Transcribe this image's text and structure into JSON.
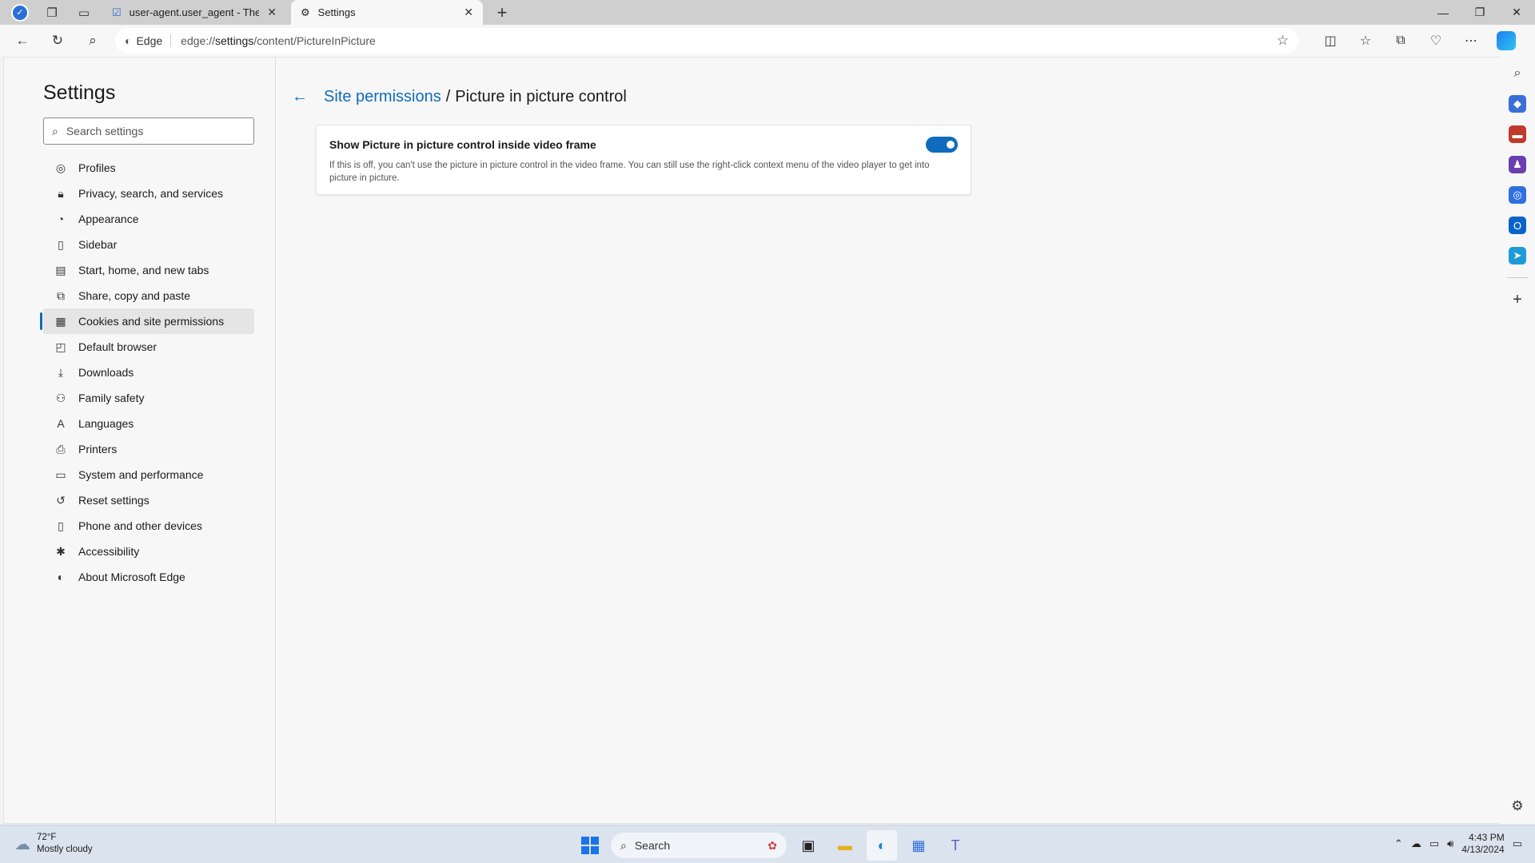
{
  "browser": {
    "tabs": [
      {
        "title": "user-agent.user_agent - The Coll",
        "active": false
      },
      {
        "title": "Settings",
        "active": true
      }
    ],
    "omnibox": {
      "brand": "Edge",
      "url_prefix": "edge://",
      "url_host": "settings",
      "url_path": "/content/PictureInPicture"
    }
  },
  "settings": {
    "title": "Settings",
    "search_placeholder": "Search settings",
    "nav_items": [
      {
        "label": "Profiles",
        "icon": "profile-icon"
      },
      {
        "label": "Privacy, search, and services",
        "icon": "lock-icon"
      },
      {
        "label": "Appearance",
        "icon": "appearance-icon"
      },
      {
        "label": "Sidebar",
        "icon": "sidebar-icon"
      },
      {
        "label": "Start, home, and new tabs",
        "icon": "home-icon"
      },
      {
        "label": "Share, copy and paste",
        "icon": "share-icon"
      },
      {
        "label": "Cookies and site permissions",
        "icon": "cookie-icon",
        "selected": true
      },
      {
        "label": "Default browser",
        "icon": "browser-icon"
      },
      {
        "label": "Downloads",
        "icon": "download-icon"
      },
      {
        "label": "Family safety",
        "icon": "family-icon"
      },
      {
        "label": "Languages",
        "icon": "language-icon"
      },
      {
        "label": "Printers",
        "icon": "printer-icon"
      },
      {
        "label": "System and performance",
        "icon": "system-icon"
      },
      {
        "label": "Reset settings",
        "icon": "reset-icon"
      },
      {
        "label": "Phone and other devices",
        "icon": "phone-icon"
      },
      {
        "label": "Accessibility",
        "icon": "accessibility-icon"
      },
      {
        "label": "About Microsoft Edge",
        "icon": "edge-icon"
      }
    ]
  },
  "page": {
    "breadcrumb_parent": "Site permissions",
    "breadcrumb_separator": "/",
    "breadcrumb_current": "Picture in picture control",
    "setting": {
      "title": "Show Picture in picture control inside video frame",
      "description": "If this is off, you can't use the picture in picture control in the video frame. You can still use the right-click context menu of the video player to get into picture in picture.",
      "enabled": true
    }
  },
  "taskbar": {
    "weather_temp": "72°F",
    "weather_desc": "Mostly cloudy",
    "search_label": "Search",
    "time": "4:43 PM",
    "date": "4/13/2024"
  },
  "colors": {
    "accent": "#0f6cbd",
    "toggle_on": "#0f6cbd"
  }
}
